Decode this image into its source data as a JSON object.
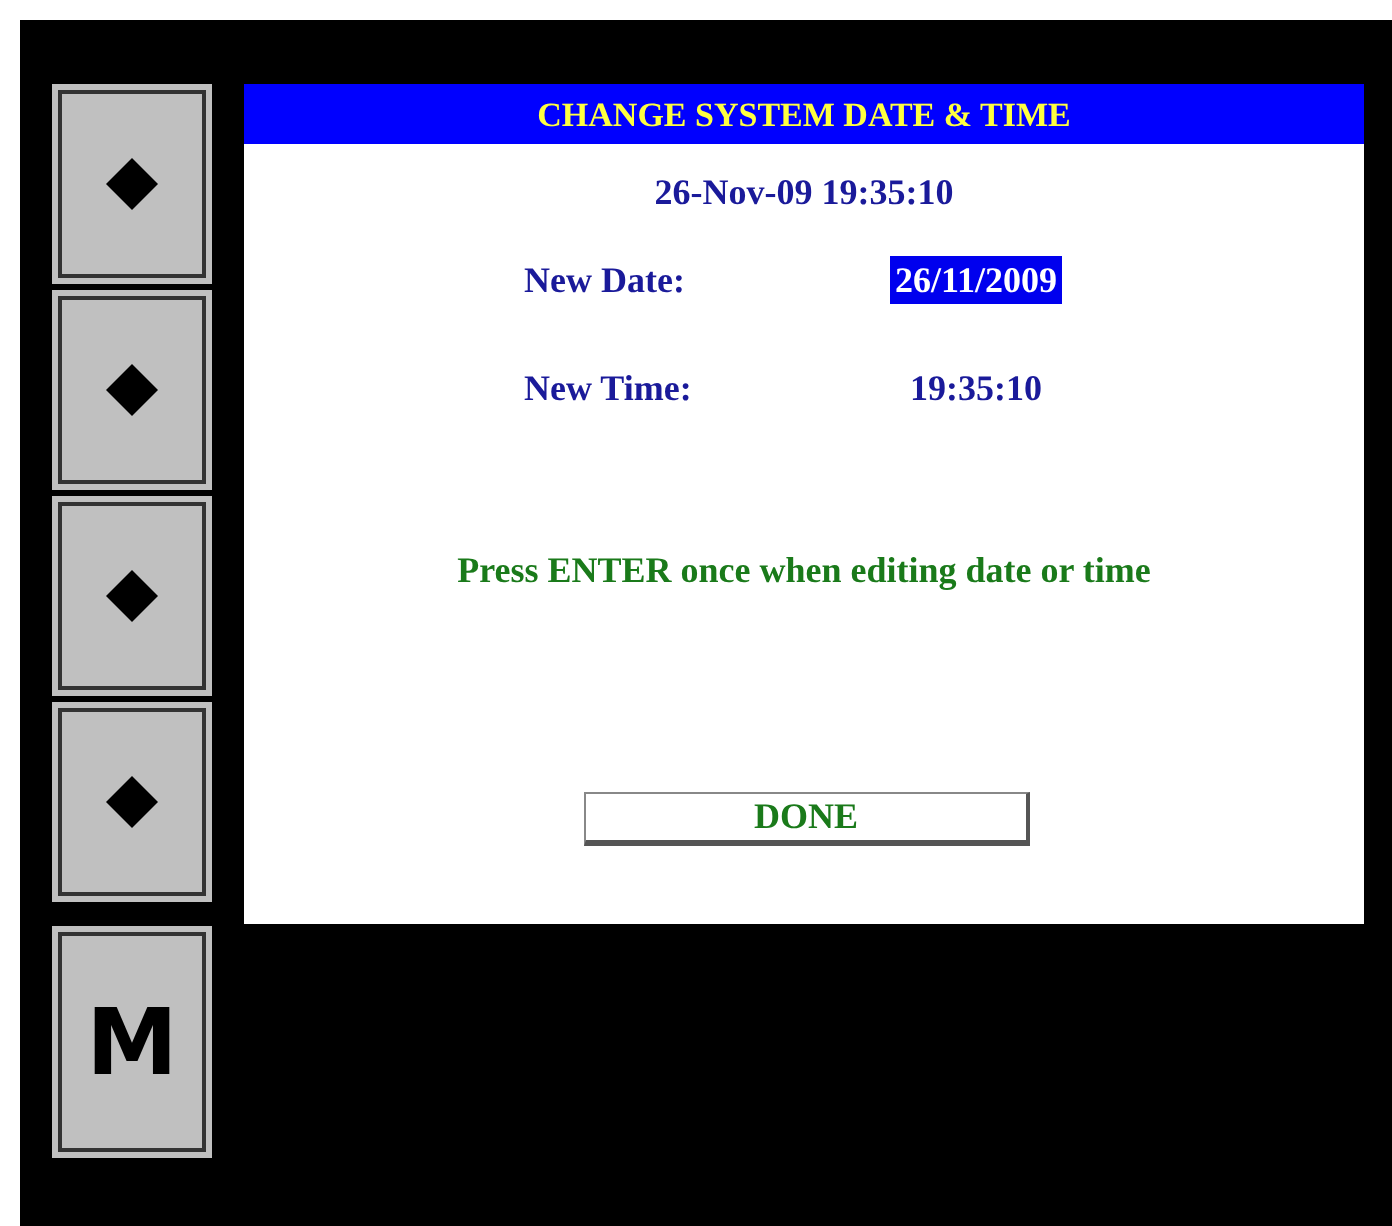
{
  "side_buttons": [
    {
      "kind": "diamond"
    },
    {
      "kind": "diamond"
    },
    {
      "kind": "diamond"
    },
    {
      "kind": "diamond"
    },
    {
      "kind": "letter",
      "label": "M"
    }
  ],
  "dialog": {
    "title": "CHANGE SYSTEM DATE & TIME",
    "current": "26-Nov-09 19:35:10",
    "fields": [
      {
        "label": "New Date:",
        "value": "26/11/2009",
        "selected": true
      },
      {
        "label": "New Time:",
        "value": "19:35:10",
        "selected": false
      }
    ],
    "message": "Press ENTER once when editing date or time",
    "button": "DONE"
  }
}
